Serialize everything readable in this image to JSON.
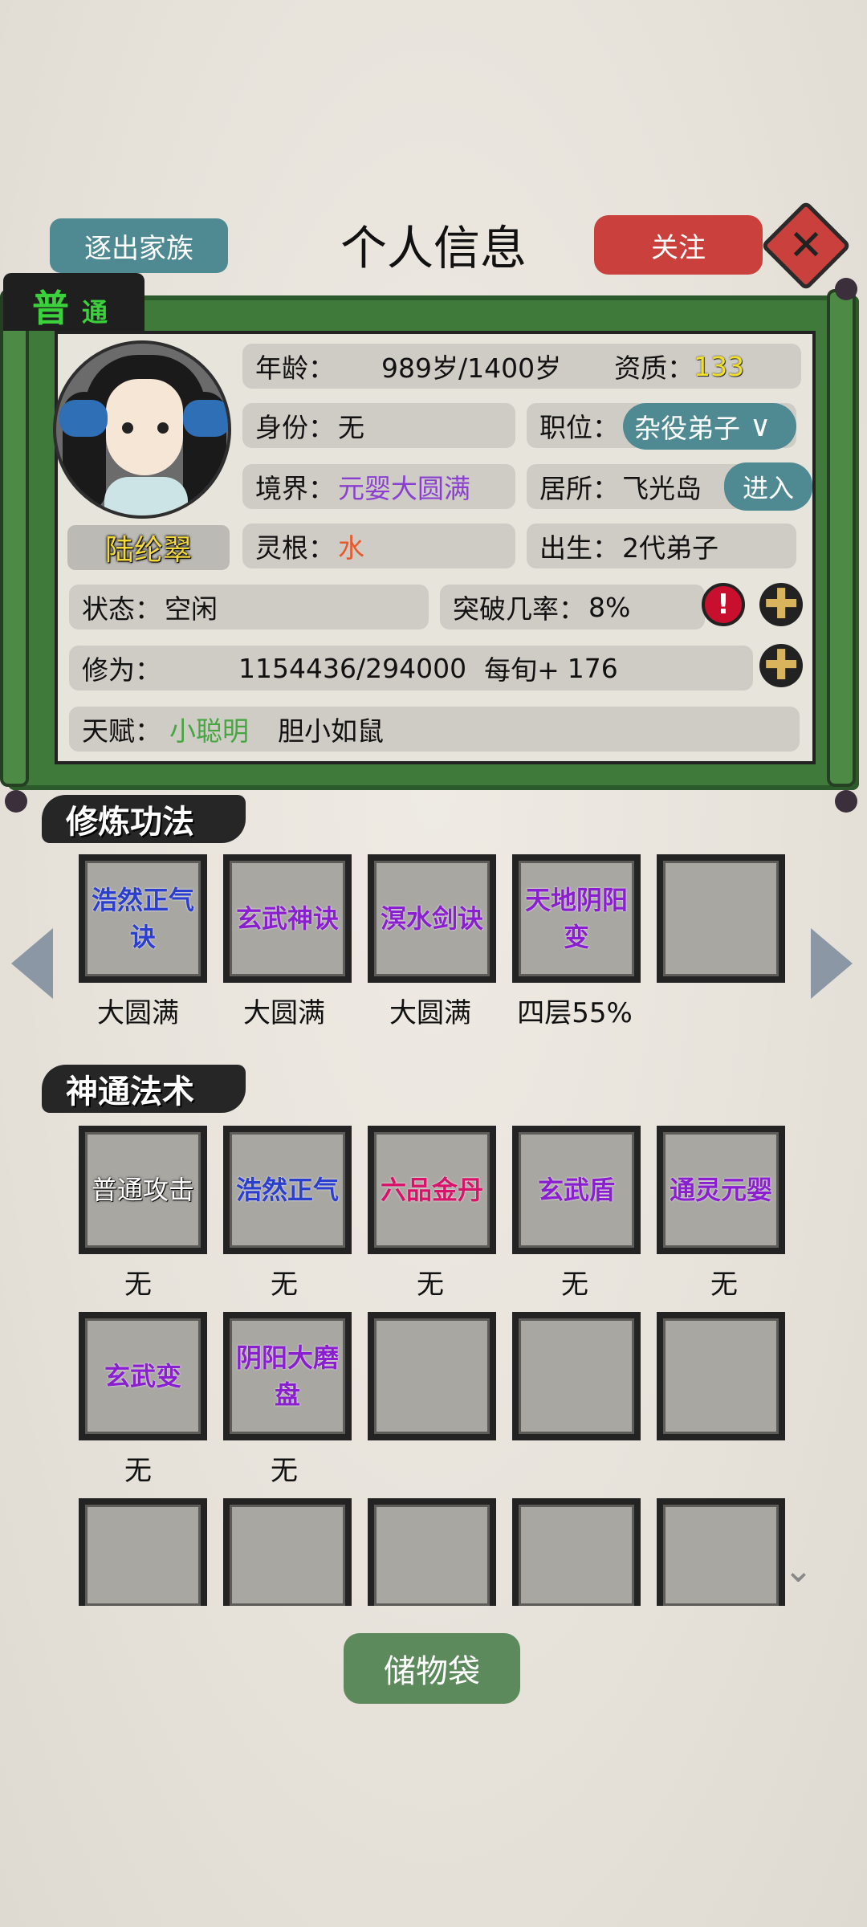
{
  "header": {
    "title": "个人信息",
    "expel_label": "逐出家族",
    "follow_label": "关注",
    "close_symbol": "✕"
  },
  "profile": {
    "rank_tab_big": "普",
    "rank_tab_small": "通",
    "name": "陆纶翠",
    "age_label": "年龄：",
    "age_value": "989岁/1400岁",
    "aptitude_label": "资质：",
    "aptitude_value": "133",
    "identity_label": "身份：",
    "identity_value": "无",
    "position_label": "职位：",
    "position_value": "杂役弟子",
    "realm_label": "境界：",
    "realm_value": "元婴大圆满",
    "residence_label": "居所：",
    "residence_value": "飞光岛",
    "enter_label": "进入",
    "root_label": "灵根：",
    "root_value": "水",
    "birth_label": "出生：",
    "birth_value": "2代弟子",
    "status_label": "状态：",
    "status_value": "空闲",
    "breakthrough_label": "突破几率：",
    "breakthrough_value": "8%",
    "cultivation_label": "修为：",
    "cultivation_value": "1154436/294000",
    "per_turn_label": "每旬+",
    "per_turn_value": "176",
    "talent_label": "天赋：",
    "talent_1": "小聪明",
    "talent_2": "胆小如鼠",
    "alert_symbol": "!",
    "plus_symbol": "✚"
  },
  "techniques": {
    "title": "修炼功法",
    "items": [
      {
        "name": "浩然正气诀",
        "level": "大圆满"
      },
      {
        "name": "玄武神诀",
        "level": "大圆满"
      },
      {
        "name": "溟水剑诀",
        "level": "大圆满"
      },
      {
        "name": "天地阴阳变",
        "level": "四层55%"
      },
      {
        "name": "",
        "level": ""
      }
    ]
  },
  "spells": {
    "title": "神通法术",
    "items": [
      {
        "name": "普通攻击",
        "level": "无"
      },
      {
        "name": "浩然正气",
        "level": "无"
      },
      {
        "name": "六品金丹",
        "level": "无"
      },
      {
        "name": "玄武盾",
        "level": "无"
      },
      {
        "name": "通灵元婴",
        "level": "无"
      },
      {
        "name": "玄武变",
        "level": "无"
      },
      {
        "name": "阴阳大磨盘",
        "level": "无"
      }
    ]
  },
  "footer": {
    "bag_label": "储物袋"
  },
  "icons": {
    "left_arrow": "chevron-left-icon",
    "right_arrow": "chevron-right-icon",
    "scroll_down": "chevron-down-icon"
  },
  "colors": {
    "rank_green": "#3ad13a",
    "button_teal": "#4f8a93",
    "follow_red": "#c9403c",
    "realm_purple": "#8a3fd1",
    "root_orange": "#e8592a",
    "talent_green": "#46a640",
    "aptitude_yellow": "#f1df2a"
  }
}
